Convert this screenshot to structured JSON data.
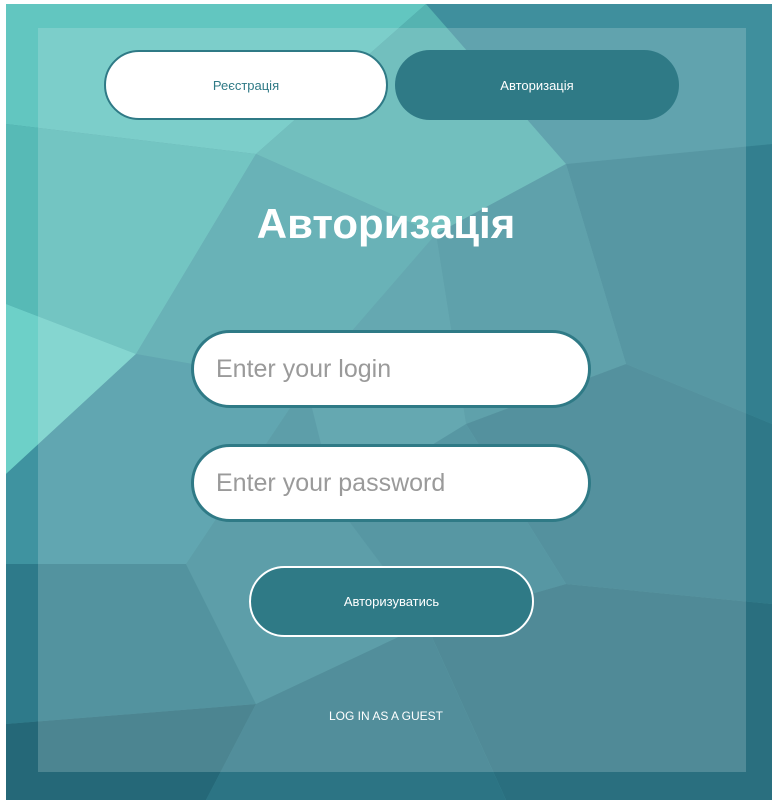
{
  "tabs": {
    "register_label": "Реєстрація",
    "login_label": "Авторизація"
  },
  "form": {
    "title": "Авторизація",
    "login_placeholder": "Enter your login",
    "password_placeholder": "Enter your password",
    "submit_label": "Авторизуватись",
    "guest_link": "LOG IN AS A GUEST"
  },
  "colors": {
    "accent": "#2f7a86",
    "background_light": "#6fd6cc",
    "background_dark": "#2a6f7f",
    "text_on_accent": "#ffffff"
  }
}
